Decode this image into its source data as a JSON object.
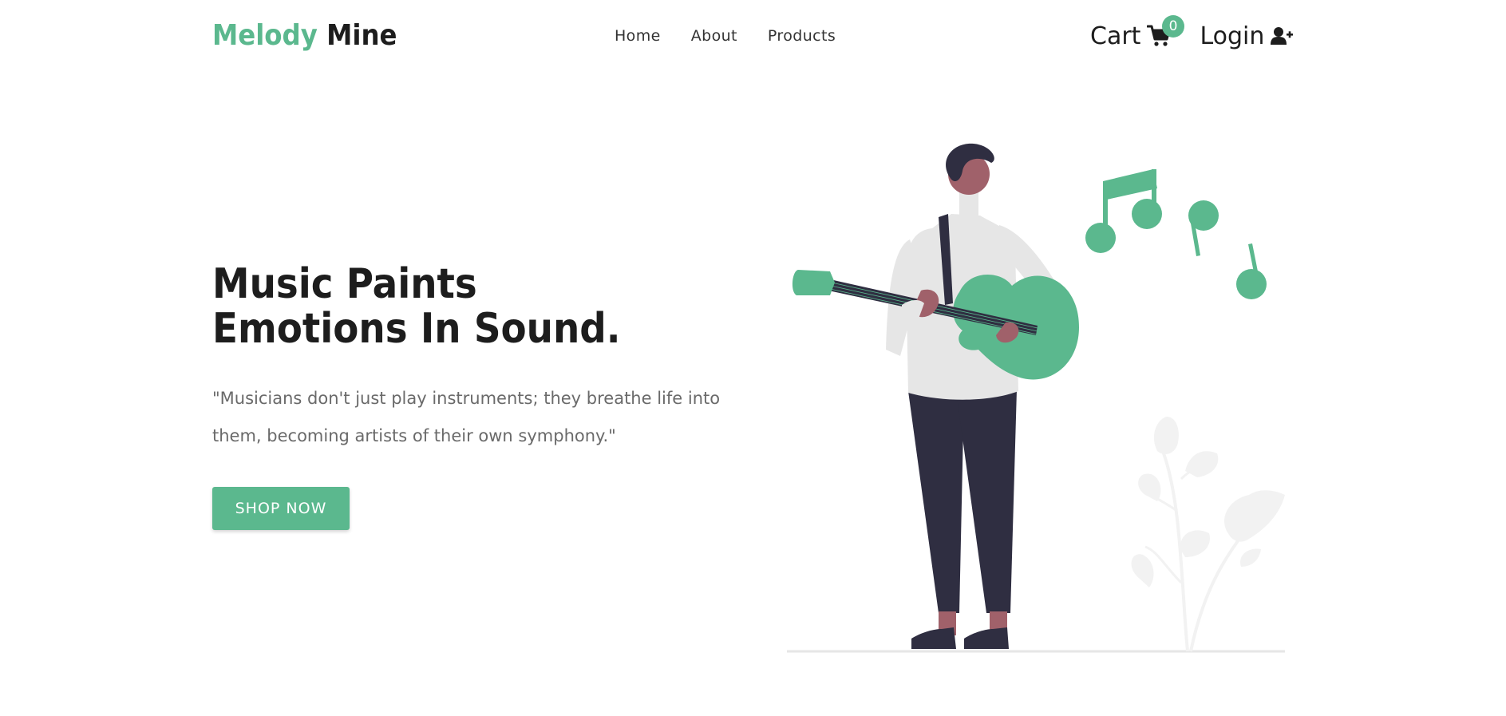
{
  "brand": {
    "part1": "Melody",
    "part2": "Mine"
  },
  "nav": {
    "links": [
      "Home",
      "About",
      "Products"
    ],
    "cart_label": "Cart",
    "cart_count": "0",
    "login_label": "Login"
  },
  "hero": {
    "title_line1": "Music Paints",
    "title_line2": "Emotions In Sound.",
    "quote": "\"Musicians don't just play instruments; they breathe life into them, becoming artists of their own symphony.\"",
    "cta_label": "SHOP NOW"
  },
  "icons": {
    "cart": "shopping-cart-icon",
    "login": "user-plus-icon"
  },
  "colors": {
    "accent": "#5bb88e",
    "text_dark": "#1d1d1d",
    "text_muted": "#6a6a6a",
    "figure_dark": "#2f2e41",
    "skin": "#a0616a",
    "shirt": "#e6e6e6",
    "plant": "#f2f2f2"
  }
}
